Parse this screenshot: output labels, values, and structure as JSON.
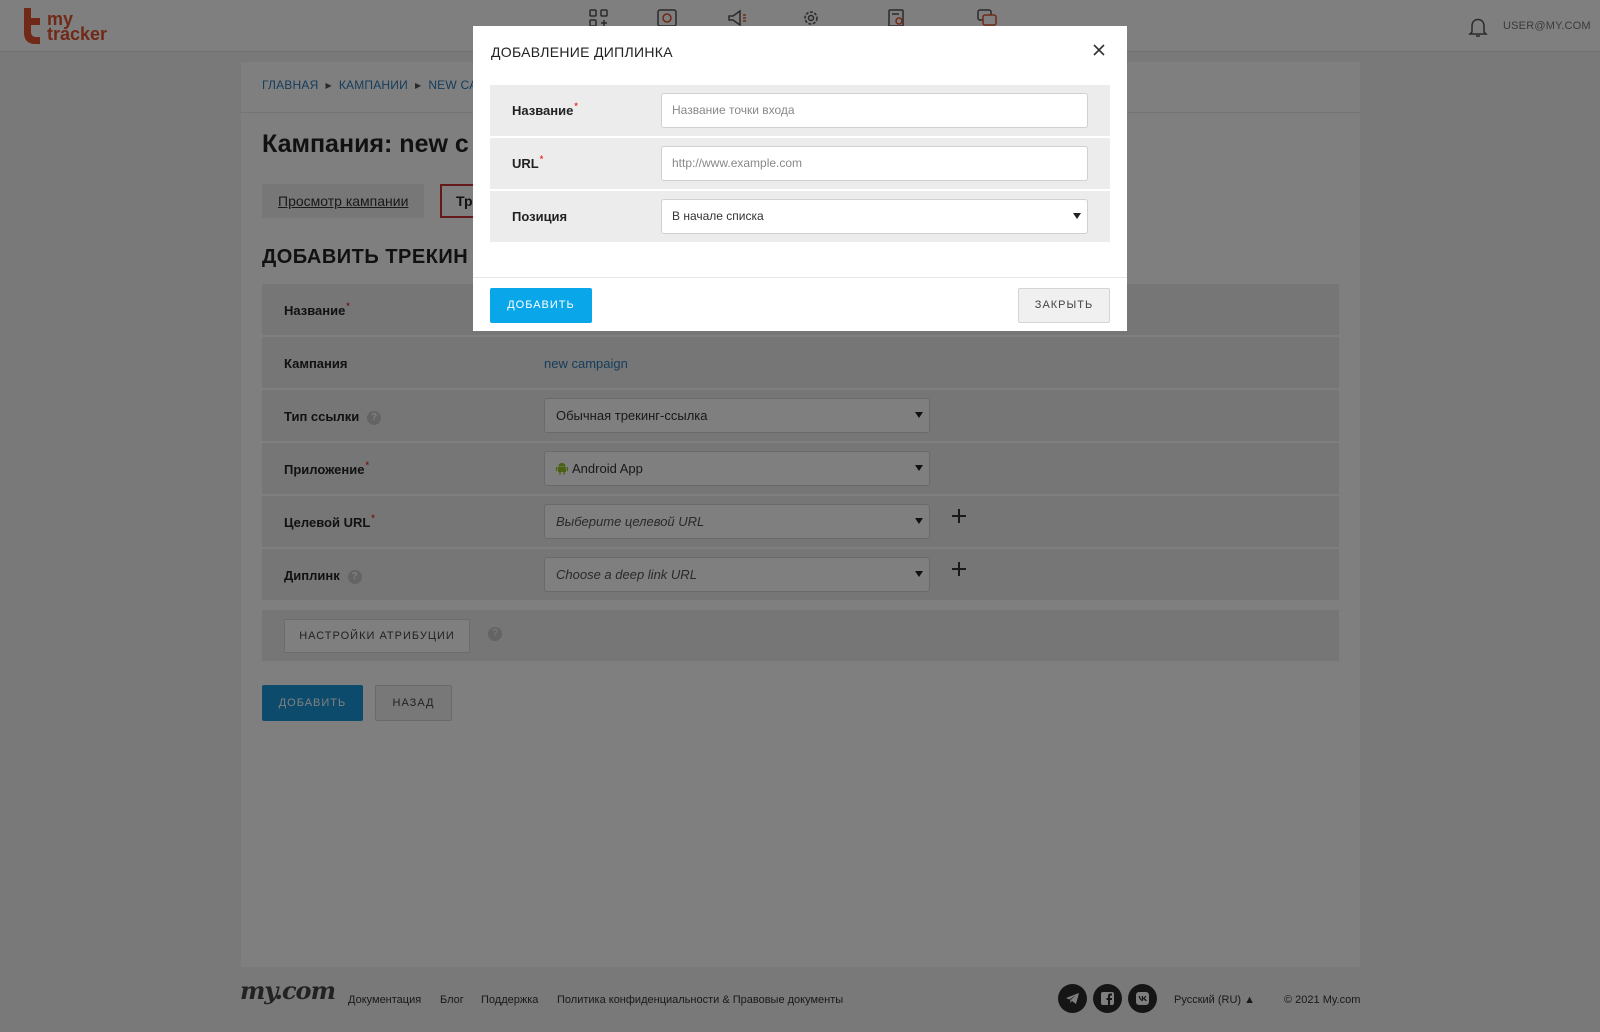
{
  "header": {
    "logo_text_line1": "my",
    "logo_text_line2": "tracker",
    "nav_icons": [
      "apps-icon",
      "dashboard-chart-icon",
      "campaign-megaphone-icon",
      "settings-gear-icon",
      "report-search-icon",
      "chat-icon"
    ],
    "user": "USER@MY.COM"
  },
  "breadcrumbs": [
    {
      "label": "ГЛАВНАЯ"
    },
    {
      "label": "КАМПАНИИ"
    },
    {
      "label": "NEW CA"
    }
  ],
  "page": {
    "title": "Кампания: new c",
    "tab_view": "Просмотр кампании",
    "tab_tracking": "Тр",
    "section_title": "ДОБАВИТЬ ТРЕКИН"
  },
  "form": {
    "name_label": "Название",
    "campaign_label": "Кампания",
    "campaign_value": "new campaign",
    "link_type_label": "Тип ссылки",
    "link_type_value": "Обычная трекинг-ссылка",
    "app_label": "Приложение",
    "app_value": "Android App",
    "target_url_label": "Целевой URL",
    "target_url_placeholder": "Выберите целевой URL",
    "deeplink_label": "Диплинк",
    "deeplink_placeholder": "Choose a deep link URL",
    "attribution_button": "НАСТРОЙКИ АТРИБУЦИИ",
    "add_button": "ДОБАВИТЬ",
    "back_button": "НАЗАД",
    "required_mark": "*",
    "help_mark": "?"
  },
  "footer": {
    "logo": "my.com",
    "links": [
      "Документация",
      "Блог",
      "Поддержка",
      "Политика конфиденциальности & Правовые документы"
    ],
    "social": [
      "telegram-icon",
      "facebook-icon",
      "vk-icon"
    ],
    "language": "Русский (RU) ▲",
    "copyright": "© 2021 My.com"
  },
  "modal": {
    "title": "ДОБАВЛЕНИЕ ДИПЛИНКА",
    "name_label": "Название",
    "name_placeholder": "Название точки входа",
    "url_label": "URL",
    "url_placeholder": "http://www.example.com",
    "position_label": "Позиция",
    "position_value": "В начале списка",
    "add_button": "ДОБАВИТЬ",
    "close_button": "ЗАКРЫТЬ"
  },
  "colors": {
    "brand": "#e0532d",
    "primary_button": "#1997d8",
    "modal_primary_button": "#0aa6ea",
    "link": "#2a7ab8",
    "required": "#e33333"
  }
}
